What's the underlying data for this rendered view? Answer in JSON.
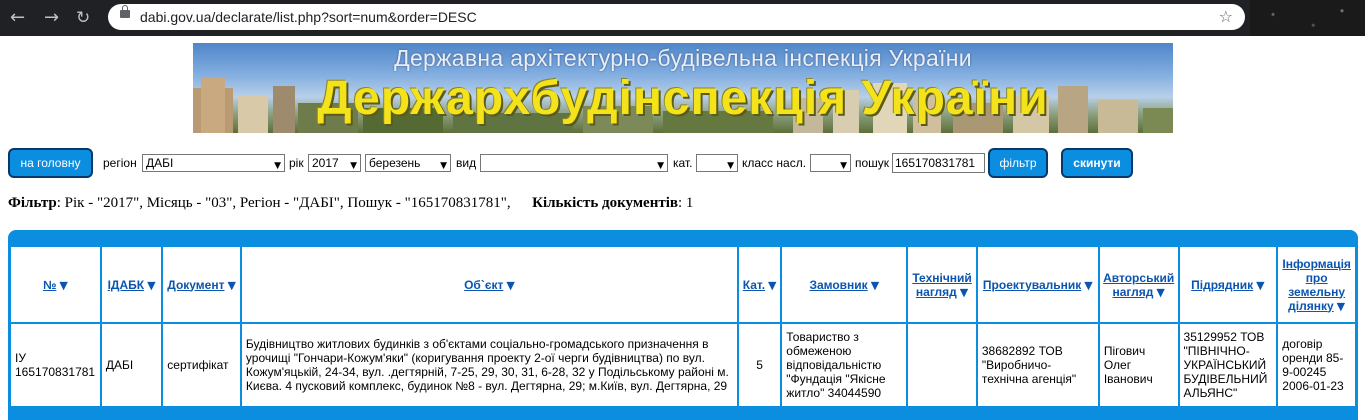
{
  "browser": {
    "url": "dabi.gov.ua/declarate/list.php?sort=num&order=DESC",
    "back_icon": "←",
    "forward_icon": "→",
    "reload_icon": "↻",
    "star_icon": "☆"
  },
  "banner": {
    "subtitle": "Державна архітектурно-будівельна інспекція України",
    "title": "Держархбудінспекція України"
  },
  "filters": {
    "home_button": "на головну",
    "region_label": "регіон",
    "region_value": "ДАБІ",
    "year_label": "рік",
    "year_value": "2017",
    "month_value": "березень",
    "kind_label": "вид",
    "kind_value": "",
    "cat_label": "кат.",
    "cat_value": "",
    "class_label": "класс насл.",
    "class_value": "",
    "search_label": "пошук",
    "search_value": "165170831781",
    "filter_button": "фільтр",
    "reset_button": "скинути",
    "dropdown_arrow": "▼"
  },
  "filter_summary": {
    "filter_label": "Фільтр",
    "filter_text": ": Рік - \"2017\", Місяць - \"03\", Регіон - \"ДАБІ\", Пошук - \"165170831781\",",
    "count_label": "Кількість документів",
    "count_text": ": 1"
  },
  "table": {
    "sort_icon": "▼",
    "headers": [
      "№",
      "ІДАБК",
      "Документ",
      "Об`єкт",
      "Кат.",
      "Замовник",
      "Технічний нагляд",
      "Проектувальник",
      "Авторський нагляд",
      "Підрядник",
      "Інформація про земельну ділянку"
    ],
    "rows": [
      {
        "num": "ІУ 165170831781",
        "idabk": "ДАБІ",
        "document": "сертифікат",
        "object": "Будівництво житлових будинків з об'єктами соціально-громадського призначення в урочищі \"Гончари-Кожум'яки\" (коригування проекту 2-ої черги будівництва) по вул. Кожум'яцькій, 24-34, вул. .дегтярній, 7-25, 29, 30, 31, 6-28, 32 у Подільському районі м. Києва. 4 пусковий комплекс, будинок №8 - вул. Дегтярна, 29; м.Київ, вул. Дегтярна, 29",
        "cat": "5",
        "customer": "Товариство з обмеженою відповідальністю \"Фундація \"Якісне житло\" 34044590",
        "tech_supervision": "",
        "designer": "38682892 ТОВ \"Виробничо-технічна агенція\"",
        "author_supervision": "Пігович Олег Іванович",
        "contractor": "35129952 ТОВ \"ПІВНІЧНО-УКРАЇНСЬКИЙ БУДІВЕЛЬНИЙ АЛЬЯНС\"",
        "land_info": "договір оренди 85-9-00245 2006-01-23"
      }
    ]
  }
}
